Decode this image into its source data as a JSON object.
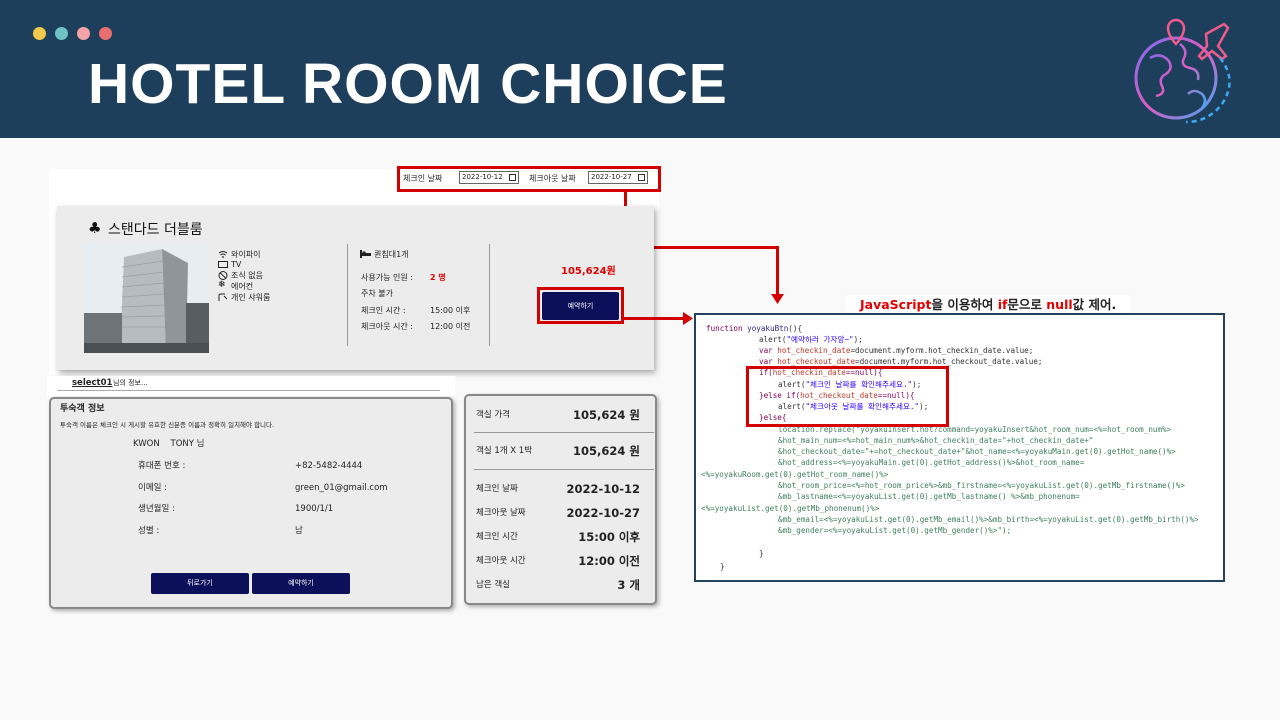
{
  "header": {
    "title": "HOTEL ROOM CHOICE",
    "dots": [
      "#f2c94c",
      "#6fc3c3",
      "#f4a3a8",
      "#e76f6f"
    ]
  },
  "booking": {
    "checkin_label": "체크인 날짜",
    "checkin_value": "2022-10-12",
    "checkout_label": "체크아웃 날짜",
    "checkout_value": "2022-10-27"
  },
  "room": {
    "name": "스탠다드 더블룸",
    "amenities": [
      "와이파이",
      "TV",
      "조식 없음",
      "에어컨",
      "개인 샤워룸"
    ],
    "bed": "퀸침대1개",
    "capacity_label": "사용가능 인원 :",
    "capacity_value": "2 명",
    "parking": "주차 불가",
    "checkin_time_label": "체크인 시간 :",
    "checkin_time_value": "15:00 이후",
    "checkout_time_label": "체크아웃 시간 :",
    "checkout_time_value": "12:00 이전",
    "price": "105,624원",
    "reserve_button": "예약하기"
  },
  "user_line": {
    "user": "select01",
    "suffix": "님의 정보..."
  },
  "guest": {
    "title": "투숙객 정보",
    "notice": "투숙객 이름은 체크인 시 게시할 유효한 신분증 이름과 정확히 일치해야 합니다.",
    "name": "KWON    TONY 님",
    "phone_label": "휴대폰 번호 :",
    "phone_value": "+82-5482-4444",
    "email_label": "이메일 :",
    "email_value": "green_01@gmail.com",
    "birth_label": "생년월일 :",
    "birth_value": "1900/1/1",
    "gender_label": "성별 :",
    "gender_value": "남",
    "back_button": "뒤로가기",
    "reserve_button": "예약하기"
  },
  "summary": {
    "rows": [
      {
        "label": "객실 가격",
        "value": "105,624 원"
      },
      {
        "label": "객실 1개 X 1박",
        "value": "105,624 원"
      },
      {
        "label": "체크인 날짜",
        "value": "2022-10-12"
      },
      {
        "label": "체크아웃 날짜",
        "value": "2022-10-27"
      },
      {
        "label": "체크인 시간",
        "value": "15:00 이후"
      },
      {
        "label": "체크아웃 시간",
        "value": "12:00 이전"
      },
      {
        "label": "남은 객실",
        "value": "3 개"
      }
    ]
  },
  "annotation": {
    "p1": "JavaScript",
    "p2": "을 이용하여 ",
    "p3": "if",
    "p4": "문으로 ",
    "p5": "null",
    "p6": "값 제어."
  },
  "code": {
    "l1a": "function",
    "l1b": " yoyakuBtn",
    "l1c": "(){",
    "l2a": "alert(",
    "l2b": "\"예약하러 가자앙~\"",
    "l2c": ");",
    "l3a": "var",
    "l3b": " hot_checkin_date",
    "l3c": "=document.myform.hot_checkin_date.value;",
    "l4a": "var",
    "l4b": " hot_checkout_date",
    "l4c": "=document.myform.hot_checkout_date.value;",
    "l5a": "if(",
    "l5b": "hot_checkin_date",
    "l5c": "==null){",
    "l6a": "alert(",
    "l6b": "\"체크인 날짜를 확인해주세요.\"",
    "l6c": ");",
    "l7a": "}else if(",
    "l7b": "hot_checkout_date",
    "l7c": "==null){",
    "l8a": "alert(",
    "l8b": "\"체크아웃 날짜를 확인해주세요.\"",
    "l8c": ");",
    "l9": "}else{",
    "l10": "location.replace(\"yoyakuInsert.hot?command=yoyakuInsert&hot_room_num=<%=hot_room_num%>",
    "l11": "&hot_main_num=<%=hot_main_num%>&hot_checkin_date=\"+hot_checkin_date+\"",
    "l12": "&hot_checkout_date=\"+=hot_checkout_date+\"&hot_name=<%=yoyakuMain.get(0).getHot_name()%>",
    "l13": "&hot_address=<%=yoyakuMain.get(0).getHot_address()%>&hot_room_name=",
    "l14": "<%=yoyakuRoom.get(0).getHot_room_name()%>",
    "l15": "&hot_room_price=<%=hot_room_price%>&mb_firstname=<%=yoyakuList.get(0).getMb_firstname()%>",
    "l16": "&mb_lastname=<%=yoyakuList.get(0).getMb_lastname() %>&mb_phonenum=",
    "l17": "<%=yoyakuList.get(0).getMb_phonenum()%>",
    "l18": "&mb_email=<%=yoyakuList.get(0).getMb_email()%>&mb_birth=<%=yoyakuList.get(0).getMb_birth()%>",
    "l19": "&mb_gender=<%=yoyakuList.get(0).getMb_gender()%>\");",
    "l20": "}",
    "l21": "}"
  }
}
